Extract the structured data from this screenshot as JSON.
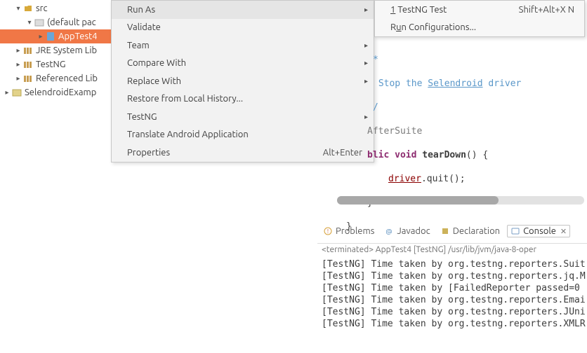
{
  "tree": {
    "src": "src",
    "default_pkg": "(default pac",
    "app_test": "AppTest4",
    "jre": "JRE System Lib",
    "testng": "TestNG",
    "referenced": "Referenced Lib",
    "selendroid": "SelendroidExamp"
  },
  "menu": {
    "run_as": "Run As",
    "validate": "Validate",
    "team": "Team",
    "compare_with": "Compare With",
    "replace_with": "Replace With",
    "restore": "Restore from Local History...",
    "testng": "TestNG",
    "translate": "Translate Android Application",
    "properties": "Properties",
    "properties_accel": "Alt+Enter"
  },
  "submenu": {
    "testng_prefix": "1",
    "testng_test": " TestNG Test",
    "testng_accel": "Shift+Alt+X N",
    "run_u": "u",
    "run_prefix": "R",
    "run_config": "n Configurations..."
  },
  "editor": {
    "l1": "*",
    "l2_a": " Stop the ",
    "l2_b": "Selendroid",
    "l2_c": " driver",
    "l3": "/",
    "l4": "AfterSuite",
    "l5_a": "blic",
    "l5_b": "void",
    "l5_c": "tearDown",
    "l5_d": "() {",
    "l6_a": "driver",
    "l6_b": ".quit();",
    "l7": "}",
    "l8": "}"
  },
  "tabs": {
    "problems": "Problems",
    "javadoc": "Javadoc",
    "declaration": "Declaration",
    "console": "Console"
  },
  "terminated": "<terminated> AppTest4 [TestNG] /usr/lib/jvm/java-8-oper",
  "console": {
    "lines": [
      "[TestNG] Time taken by org.testng.reporters.Suit",
      "[TestNG] Time taken by org.testng.reporters.jq.M",
      "[TestNG] Time taken by [FailedReporter passed=0",
      "[TestNG] Time taken by org.testng.reporters.Emai",
      "[TestNG] Time taken by org.testng.reporters.JUni",
      "[TestNG] Time taken by org.testng.reporters.XMLR"
    ]
  }
}
